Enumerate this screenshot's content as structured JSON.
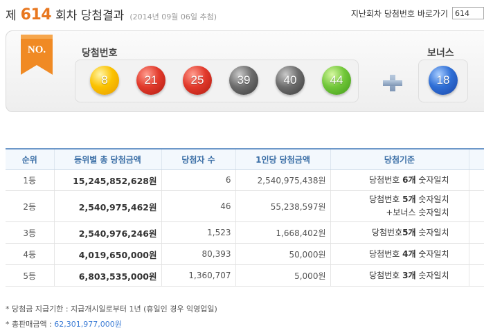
{
  "header": {
    "prefix": "제",
    "round": "614",
    "suffix": "회차 당첨결과",
    "draw_date": "(2014년 09월 06일 추첨)",
    "jump_label": "지난회차 당첨번호 바로가기",
    "jump_value": "614"
  },
  "result": {
    "no_badge": "NO.",
    "numbers_label": "당첨번호",
    "bonus_label": "보너스",
    "numbers": [
      "8",
      "21",
      "25",
      "39",
      "40",
      "44"
    ],
    "bonus": "18",
    "colors": {
      "yellow": "#fbc200",
      "red": "#e23a2c",
      "gray": "#6d6d6d",
      "green": "#72c73a",
      "blue": "#2f6fd6",
      "ribbon": "#f08a24"
    }
  },
  "table": {
    "headers": [
      "순위",
      "등위별 총 당첨금액",
      "당첨자 수",
      "1인당 당첨금액",
      "당첨기준"
    ],
    "rows": [
      {
        "rank": "1등",
        "total": "15,245,852,628원",
        "winners": "6",
        "per": "2,540,975,438원",
        "crit_a": "당첨번호 ",
        "crit_b": "6개",
        "crit_c": " 숫자일치",
        "crit_line2": ""
      },
      {
        "rank": "2등",
        "total": "2,540,975,462원",
        "winners": "46",
        "per": "55,238,597원",
        "crit_a": "당첨번호 ",
        "crit_b": "5개",
        "crit_c": " 숫자일치",
        "crit_line2": "+보너스 숫자일치"
      },
      {
        "rank": "3등",
        "total": "2,540,976,246원",
        "winners": "1,523",
        "per": "1,668,402원",
        "crit_a": "당첨번호",
        "crit_b": "5개",
        "crit_c": " 숫자일치",
        "crit_line2": ""
      },
      {
        "rank": "4등",
        "total": "4,019,650,000원",
        "winners": "80,393",
        "per": "50,000원",
        "crit_a": "당첨번호 ",
        "crit_b": "4개",
        "crit_c": " 숫자일치",
        "crit_line2": ""
      },
      {
        "rank": "5등",
        "total": "6,803,535,000원",
        "winners": "1,360,707",
        "per": "5,000원",
        "crit_a": "당첨번호 ",
        "crit_b": "3개",
        "crit_c": " 숫자일치",
        "crit_line2": ""
      }
    ]
  },
  "notes": {
    "deadline": "* 당첨금 지급기한 : 지급개시일로부터 1년 (휴일인 경우 익영업일)",
    "sales_label": "* 총판매금액 : ",
    "sales_value": "62,301,977,000원"
  }
}
